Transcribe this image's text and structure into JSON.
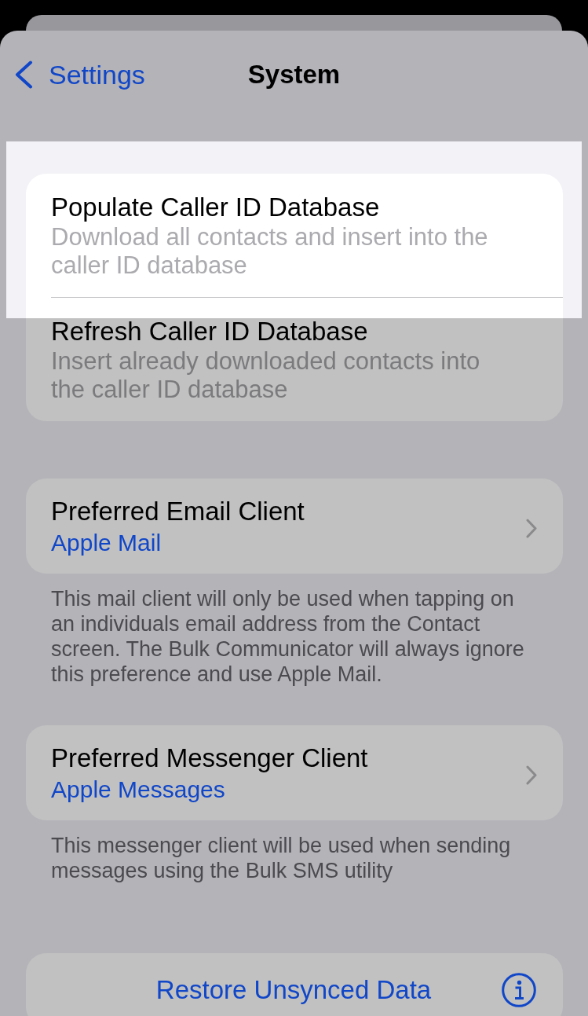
{
  "nav_bar": {
    "back_label": "Settings",
    "title": "System"
  },
  "sections": [
    {
      "rows": [
        {
          "kind": "action",
          "title": "Populate Caller ID Database",
          "subtitle": "Download all contacts and insert into the caller ID database",
          "highlighted": true
        },
        {
          "kind": "action",
          "title": "Refresh Caller ID Database",
          "subtitle": "Insert already downloaded contacts into the caller ID database",
          "highlighted": false
        }
      ]
    },
    {
      "rows": [
        {
          "kind": "link",
          "title": "Preferred Email Client",
          "value": "Apple Mail",
          "highlighted": false
        }
      ],
      "footer": "This mail client will only be used when tapping on an individuals email address from the Contact screen. The Bulk Communicator will always ignore this preference and use Apple Mail."
    },
    {
      "rows": [
        {
          "kind": "link",
          "title": "Preferred Messenger Client",
          "value": "Apple Messages",
          "highlighted": false
        }
      ],
      "footer": "This messenger client will be used when sending messages using the Bulk SMS utility"
    },
    {
      "rows": [
        {
          "kind": "button",
          "title": "Restore Unsynced Data",
          "info": true,
          "highlighted": false
        }
      ]
    }
  ]
}
